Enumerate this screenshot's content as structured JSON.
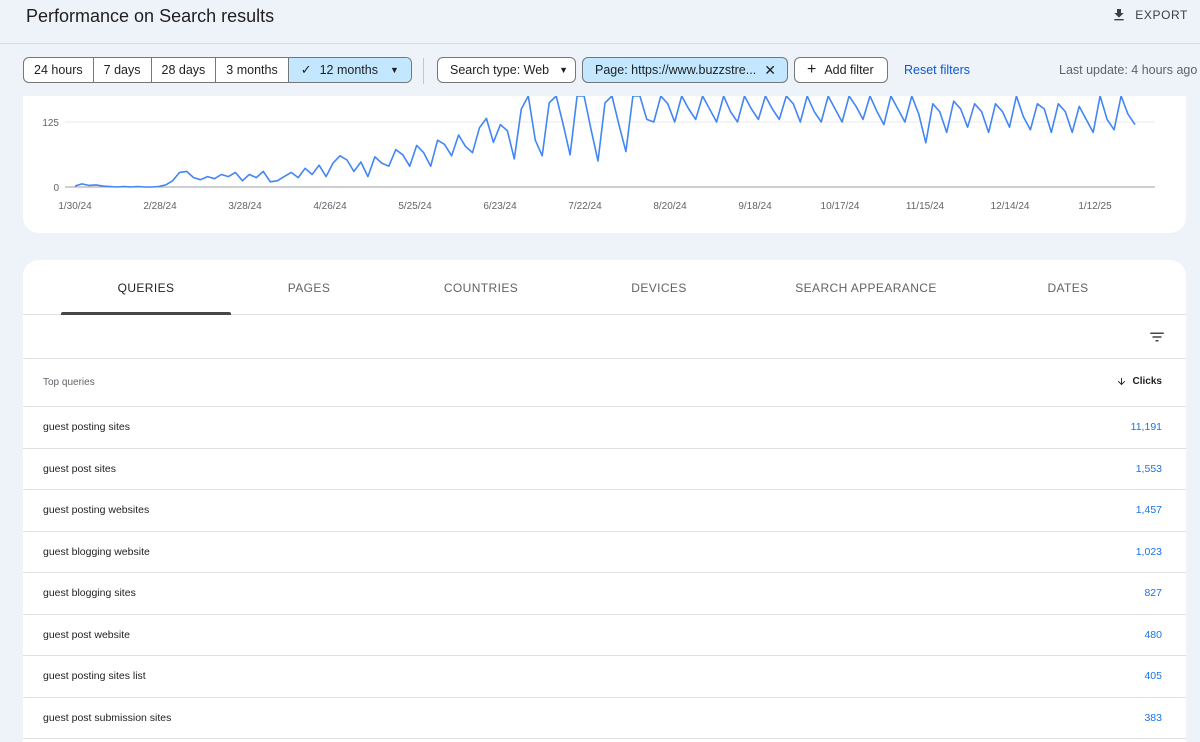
{
  "header": {
    "title": "Performance on Search results",
    "export_label": "EXPORT"
  },
  "filters": {
    "date_ranges": [
      "24 hours",
      "7 days",
      "28 days",
      "3 months"
    ],
    "selected_range": "12 months",
    "search_type": "Search type: Web",
    "page_filter": "Page: https://www.buzzstre...",
    "add_filter": "Add filter",
    "reset": "Reset filters",
    "last_update": "Last update: 4 hours ago"
  },
  "chart_data": {
    "type": "line",
    "y_ticks": [
      "125",
      "0"
    ],
    "x_ticks": [
      "1/30/24",
      "2/28/24",
      "3/28/24",
      "4/26/24",
      "5/25/24",
      "6/23/24",
      "7/22/24",
      "8/20/24",
      "9/18/24",
      "10/17/24",
      "11/15/24",
      "12/14/24",
      "1/12/25"
    ],
    "ylim": [
      0,
      175
    ],
    "color": "#4285f4",
    "series": [
      {
        "values": [
          2,
          6,
          3,
          4,
          2,
          1,
          0,
          1,
          0,
          1,
          0,
          0,
          1,
          4,
          12,
          28,
          30,
          18,
          14,
          20,
          16,
          24,
          20,
          28,
          12,
          24,
          18,
          30,
          10,
          12,
          20,
          28,
          18,
          36,
          24,
          42,
          20,
          46,
          60,
          52,
          30,
          48,
          20,
          58,
          46,
          40,
          72,
          62,
          40,
          80,
          66,
          40,
          90,
          82,
          60,
          100,
          78,
          66,
          114,
          132,
          86,
          120,
          108,
          54,
          150,
          175,
          90,
          60,
          162,
          175,
          120,
          62,
          175,
          175,
          110,
          50,
          162,
          175,
          120,
          68,
          175,
          175,
          130,
          125,
          175,
          160,
          125,
          175,
          150,
          130,
          175,
          150,
          125,
          175,
          145,
          125,
          175,
          150,
          130,
          175,
          150,
          130,
          175,
          160,
          125,
          175,
          145,
          125,
          175,
          150,
          125,
          175,
          155,
          130,
          175,
          145,
          120,
          175,
          150,
          125,
          175,
          140,
          85,
          160,
          145,
          105,
          165,
          150,
          115,
          160,
          145,
          105,
          160,
          145,
          115,
          175,
          135,
          110,
          160,
          150,
          105,
          160,
          145,
          105,
          155,
          130,
          105,
          175,
          130,
          110,
          175,
          140,
          120
        ]
      }
    ]
  },
  "table": {
    "tabs": [
      "QUERIES",
      "PAGES",
      "COUNTRIES",
      "DEVICES",
      "SEARCH APPEARANCE",
      "DATES"
    ],
    "col_query": "Top queries",
    "col_clicks": "Clicks",
    "rows": [
      {
        "query": "guest posting sites",
        "clicks": "11,191"
      },
      {
        "query": "guest post sites",
        "clicks": "1,553"
      },
      {
        "query": "guest posting websites",
        "clicks": "1,457"
      },
      {
        "query": "guest blogging website",
        "clicks": "1,023"
      },
      {
        "query": "guest blogging sites",
        "clicks": "827"
      },
      {
        "query": "guest post website",
        "clicks": "480"
      },
      {
        "query": "guest posting sites list",
        "clicks": "405"
      },
      {
        "query": "guest post submission sites",
        "clicks": "383"
      }
    ]
  }
}
